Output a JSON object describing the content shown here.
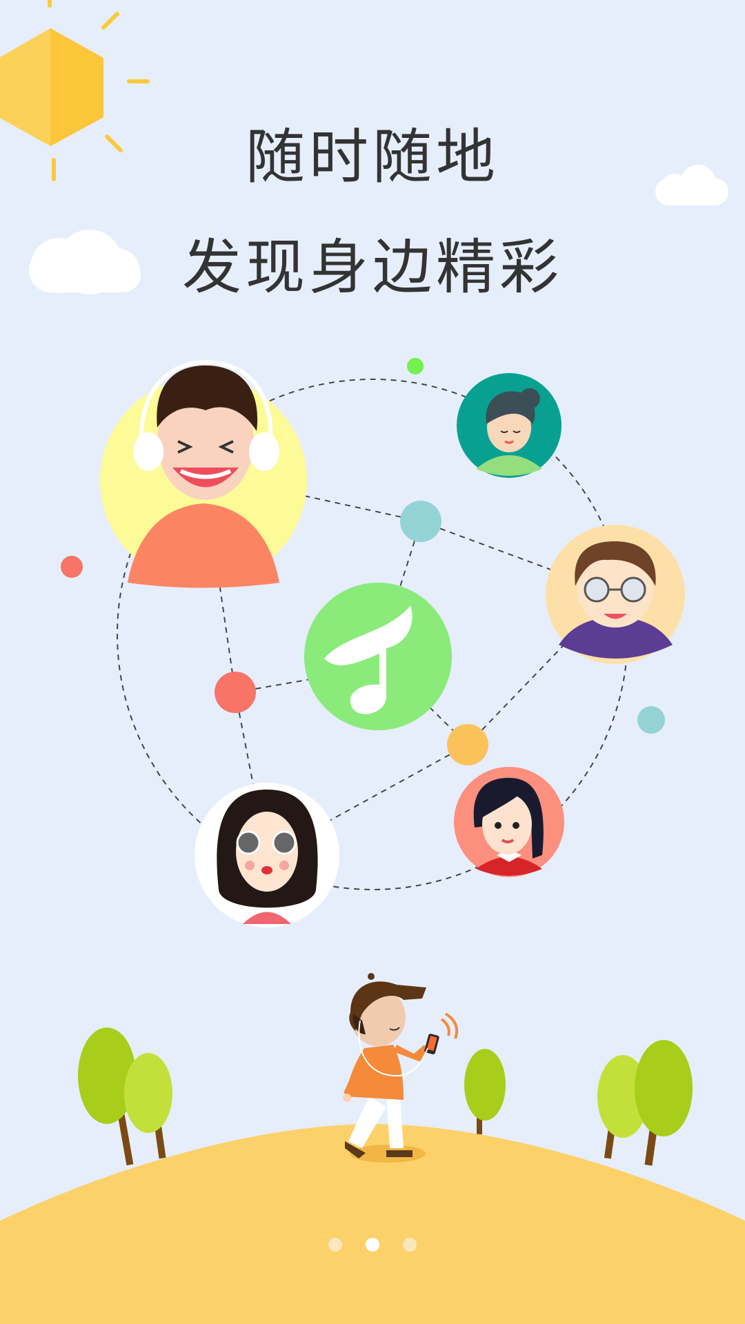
{
  "headline": {
    "line1": "随时随地",
    "line2": "发现身边精彩"
  },
  "pager": {
    "count": 3,
    "active_index": 1
  },
  "colors": {
    "background": "#e6eefc",
    "hill": "#fcd16a",
    "music_button": "#8aeb7a",
    "sun": "#fbc93d",
    "tree_light": "#c3e03a",
    "tree_dark": "#a8cd1b"
  },
  "icons": {
    "center": "music-note-icon",
    "sun": "sun-icon"
  }
}
